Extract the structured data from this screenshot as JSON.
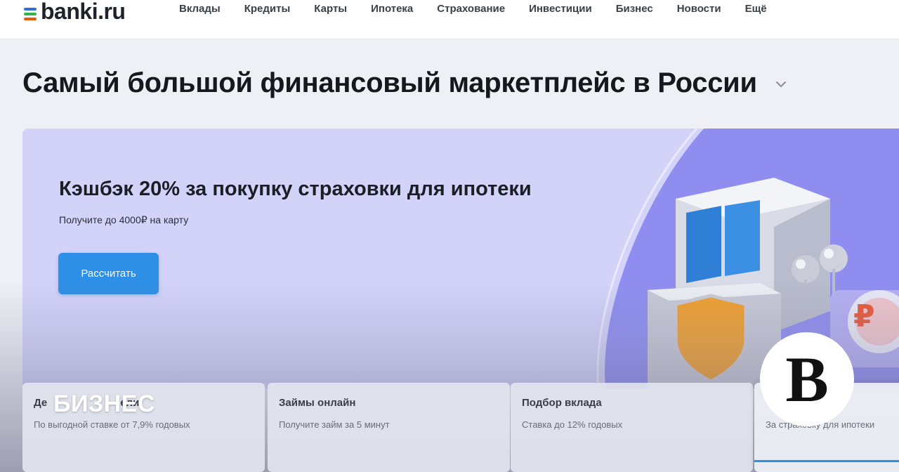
{
  "header": {
    "logo_text": "banki.ru",
    "nav": [
      "Вклады",
      "Кредиты",
      "Карты",
      "Ипотека",
      "Страхование",
      "Инвестиции",
      "Бизнес",
      "Новости",
      "Ещё"
    ]
  },
  "page": {
    "title": "Самый большой финансовый маркетплейс в России"
  },
  "banner": {
    "heading": "Кэшбэк 20% за покупку страховки для ипотеки",
    "subheading": "Получите до 4000₽ на карту",
    "button_label": "Рассчитать",
    "currency_symbol": "₽"
  },
  "cards": [
    {
      "title": "Де",
      "title_end": "ели",
      "subtitle": "По выгодной ставке от 7,9% годовых"
    },
    {
      "title": "Займы онлайн",
      "subtitle": "Получите займ за 5 минут"
    },
    {
      "title": "Подбор вклада",
      "subtitle": "Ставка до 12% годовых"
    },
    {
      "title": "",
      "subtitle": "За страховку для ипотеки"
    }
  ],
  "watermark": {
    "label": "БИЗНЕС",
    "logo_letter": "В"
  },
  "colors": {
    "banner_bg": "#d3d3fa",
    "banner_accent": "#8f8ef0",
    "button": "#2e8fe6",
    "shield": "#f0a030"
  }
}
